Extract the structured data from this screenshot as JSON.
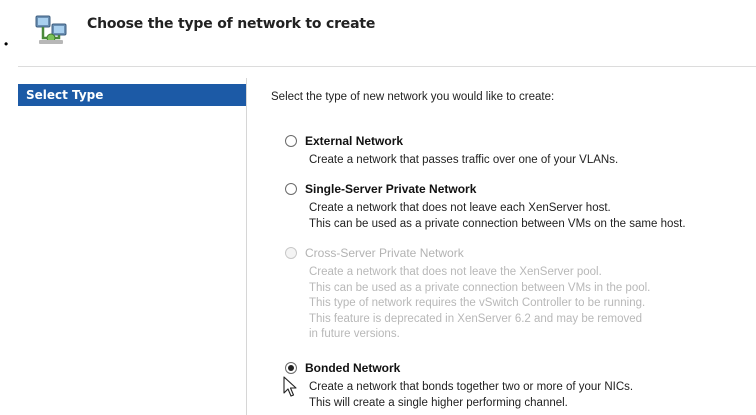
{
  "page": {
    "bullet": "•"
  },
  "header": {
    "title": "Choose the type of network to create",
    "icon": "network-wizard-icon"
  },
  "sidebar": {
    "items": [
      {
        "label": "Select Type",
        "selected": true
      }
    ]
  },
  "main": {
    "prompt": "Select the type of new network you would like to create:",
    "options": [
      {
        "title": "External Network",
        "checked": false,
        "enabled": true,
        "description": [
          "Create a network that passes traffic over one of your VLANs."
        ]
      },
      {
        "title": "Single-Server Private Network",
        "checked": false,
        "enabled": true,
        "description": [
          "Create a network that does not leave each XenServer host.",
          "This can be used as a private connection between VMs on the same host."
        ]
      },
      {
        "title": "Cross-Server Private Network",
        "checked": false,
        "enabled": false,
        "description": [
          "Create a network that does not leave the XenServer pool.",
          "This can be used as a private connection between VMs in the pool.",
          "This type of network requires the vSwitch Controller to be running.",
          "This feature is deprecated in XenServer 6.2 and may be removed",
          "in future versions."
        ]
      },
      {
        "title": "Bonded Network",
        "checked": true,
        "enabled": true,
        "description": [
          "Create a network that bonds together two or more of your NICs.",
          "This will create a single higher performing channel."
        ]
      }
    ]
  },
  "colors": {
    "selection": "#1c5aa6",
    "disabled_text": "#b8b8b8"
  }
}
